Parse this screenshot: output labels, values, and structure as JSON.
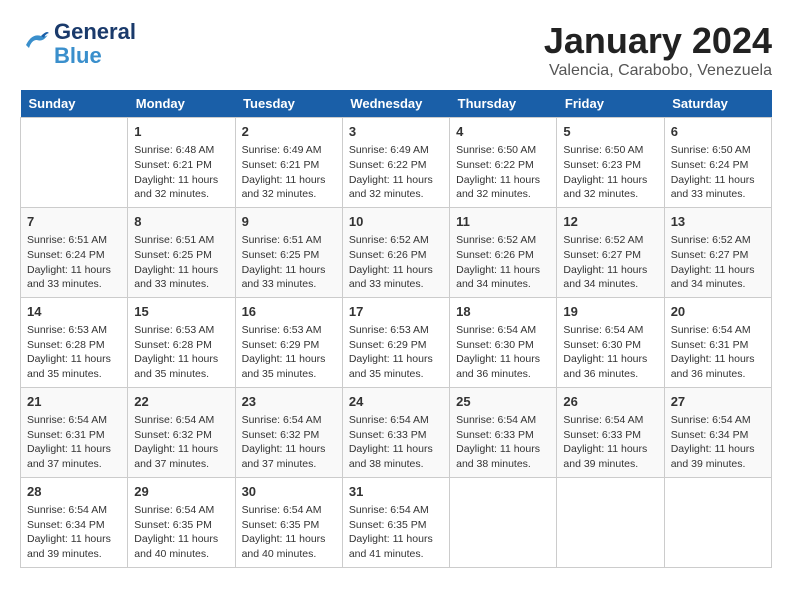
{
  "header": {
    "logo_line1": "General",
    "logo_line2": "Blue",
    "month": "January 2024",
    "location": "Valencia, Carabobo, Venezuela"
  },
  "days_of_week": [
    "Sunday",
    "Monday",
    "Tuesday",
    "Wednesday",
    "Thursday",
    "Friday",
    "Saturday"
  ],
  "weeks": [
    [
      {
        "day": "",
        "sunrise": "",
        "sunset": "",
        "daylight": ""
      },
      {
        "day": "1",
        "sunrise": "Sunrise: 6:48 AM",
        "sunset": "Sunset: 6:21 PM",
        "daylight": "Daylight: 11 hours and 32 minutes."
      },
      {
        "day": "2",
        "sunrise": "Sunrise: 6:49 AM",
        "sunset": "Sunset: 6:21 PM",
        "daylight": "Daylight: 11 hours and 32 minutes."
      },
      {
        "day": "3",
        "sunrise": "Sunrise: 6:49 AM",
        "sunset": "Sunset: 6:22 PM",
        "daylight": "Daylight: 11 hours and 32 minutes."
      },
      {
        "day": "4",
        "sunrise": "Sunrise: 6:50 AM",
        "sunset": "Sunset: 6:22 PM",
        "daylight": "Daylight: 11 hours and 32 minutes."
      },
      {
        "day": "5",
        "sunrise": "Sunrise: 6:50 AM",
        "sunset": "Sunset: 6:23 PM",
        "daylight": "Daylight: 11 hours and 32 minutes."
      },
      {
        "day": "6",
        "sunrise": "Sunrise: 6:50 AM",
        "sunset": "Sunset: 6:24 PM",
        "daylight": "Daylight: 11 hours and 33 minutes."
      }
    ],
    [
      {
        "day": "7",
        "sunrise": "Sunrise: 6:51 AM",
        "sunset": "Sunset: 6:24 PM",
        "daylight": "Daylight: 11 hours and 33 minutes."
      },
      {
        "day": "8",
        "sunrise": "Sunrise: 6:51 AM",
        "sunset": "Sunset: 6:25 PM",
        "daylight": "Daylight: 11 hours and 33 minutes."
      },
      {
        "day": "9",
        "sunrise": "Sunrise: 6:51 AM",
        "sunset": "Sunset: 6:25 PM",
        "daylight": "Daylight: 11 hours and 33 minutes."
      },
      {
        "day": "10",
        "sunrise": "Sunrise: 6:52 AM",
        "sunset": "Sunset: 6:26 PM",
        "daylight": "Daylight: 11 hours and 33 minutes."
      },
      {
        "day": "11",
        "sunrise": "Sunrise: 6:52 AM",
        "sunset": "Sunset: 6:26 PM",
        "daylight": "Daylight: 11 hours and 34 minutes."
      },
      {
        "day": "12",
        "sunrise": "Sunrise: 6:52 AM",
        "sunset": "Sunset: 6:27 PM",
        "daylight": "Daylight: 11 hours and 34 minutes."
      },
      {
        "day": "13",
        "sunrise": "Sunrise: 6:52 AM",
        "sunset": "Sunset: 6:27 PM",
        "daylight": "Daylight: 11 hours and 34 minutes."
      }
    ],
    [
      {
        "day": "14",
        "sunrise": "Sunrise: 6:53 AM",
        "sunset": "Sunset: 6:28 PM",
        "daylight": "Daylight: 11 hours and 35 minutes."
      },
      {
        "day": "15",
        "sunrise": "Sunrise: 6:53 AM",
        "sunset": "Sunset: 6:28 PM",
        "daylight": "Daylight: 11 hours and 35 minutes."
      },
      {
        "day": "16",
        "sunrise": "Sunrise: 6:53 AM",
        "sunset": "Sunset: 6:29 PM",
        "daylight": "Daylight: 11 hours and 35 minutes."
      },
      {
        "day": "17",
        "sunrise": "Sunrise: 6:53 AM",
        "sunset": "Sunset: 6:29 PM",
        "daylight": "Daylight: 11 hours and 35 minutes."
      },
      {
        "day": "18",
        "sunrise": "Sunrise: 6:54 AM",
        "sunset": "Sunset: 6:30 PM",
        "daylight": "Daylight: 11 hours and 36 minutes."
      },
      {
        "day": "19",
        "sunrise": "Sunrise: 6:54 AM",
        "sunset": "Sunset: 6:30 PM",
        "daylight": "Daylight: 11 hours and 36 minutes."
      },
      {
        "day": "20",
        "sunrise": "Sunrise: 6:54 AM",
        "sunset": "Sunset: 6:31 PM",
        "daylight": "Daylight: 11 hours and 36 minutes."
      }
    ],
    [
      {
        "day": "21",
        "sunrise": "Sunrise: 6:54 AM",
        "sunset": "Sunset: 6:31 PM",
        "daylight": "Daylight: 11 hours and 37 minutes."
      },
      {
        "day": "22",
        "sunrise": "Sunrise: 6:54 AM",
        "sunset": "Sunset: 6:32 PM",
        "daylight": "Daylight: 11 hours and 37 minutes."
      },
      {
        "day": "23",
        "sunrise": "Sunrise: 6:54 AM",
        "sunset": "Sunset: 6:32 PM",
        "daylight": "Daylight: 11 hours and 37 minutes."
      },
      {
        "day": "24",
        "sunrise": "Sunrise: 6:54 AM",
        "sunset": "Sunset: 6:33 PM",
        "daylight": "Daylight: 11 hours and 38 minutes."
      },
      {
        "day": "25",
        "sunrise": "Sunrise: 6:54 AM",
        "sunset": "Sunset: 6:33 PM",
        "daylight": "Daylight: 11 hours and 38 minutes."
      },
      {
        "day": "26",
        "sunrise": "Sunrise: 6:54 AM",
        "sunset": "Sunset: 6:33 PM",
        "daylight": "Daylight: 11 hours and 39 minutes."
      },
      {
        "day": "27",
        "sunrise": "Sunrise: 6:54 AM",
        "sunset": "Sunset: 6:34 PM",
        "daylight": "Daylight: 11 hours and 39 minutes."
      }
    ],
    [
      {
        "day": "28",
        "sunrise": "Sunrise: 6:54 AM",
        "sunset": "Sunset: 6:34 PM",
        "daylight": "Daylight: 11 hours and 39 minutes."
      },
      {
        "day": "29",
        "sunrise": "Sunrise: 6:54 AM",
        "sunset": "Sunset: 6:35 PM",
        "daylight": "Daylight: 11 hours and 40 minutes."
      },
      {
        "day": "30",
        "sunrise": "Sunrise: 6:54 AM",
        "sunset": "Sunset: 6:35 PM",
        "daylight": "Daylight: 11 hours and 40 minutes."
      },
      {
        "day": "31",
        "sunrise": "Sunrise: 6:54 AM",
        "sunset": "Sunset: 6:35 PM",
        "daylight": "Daylight: 11 hours and 41 minutes."
      },
      {
        "day": "",
        "sunrise": "",
        "sunset": "",
        "daylight": ""
      },
      {
        "day": "",
        "sunrise": "",
        "sunset": "",
        "daylight": ""
      },
      {
        "day": "",
        "sunrise": "",
        "sunset": "",
        "daylight": ""
      }
    ]
  ]
}
